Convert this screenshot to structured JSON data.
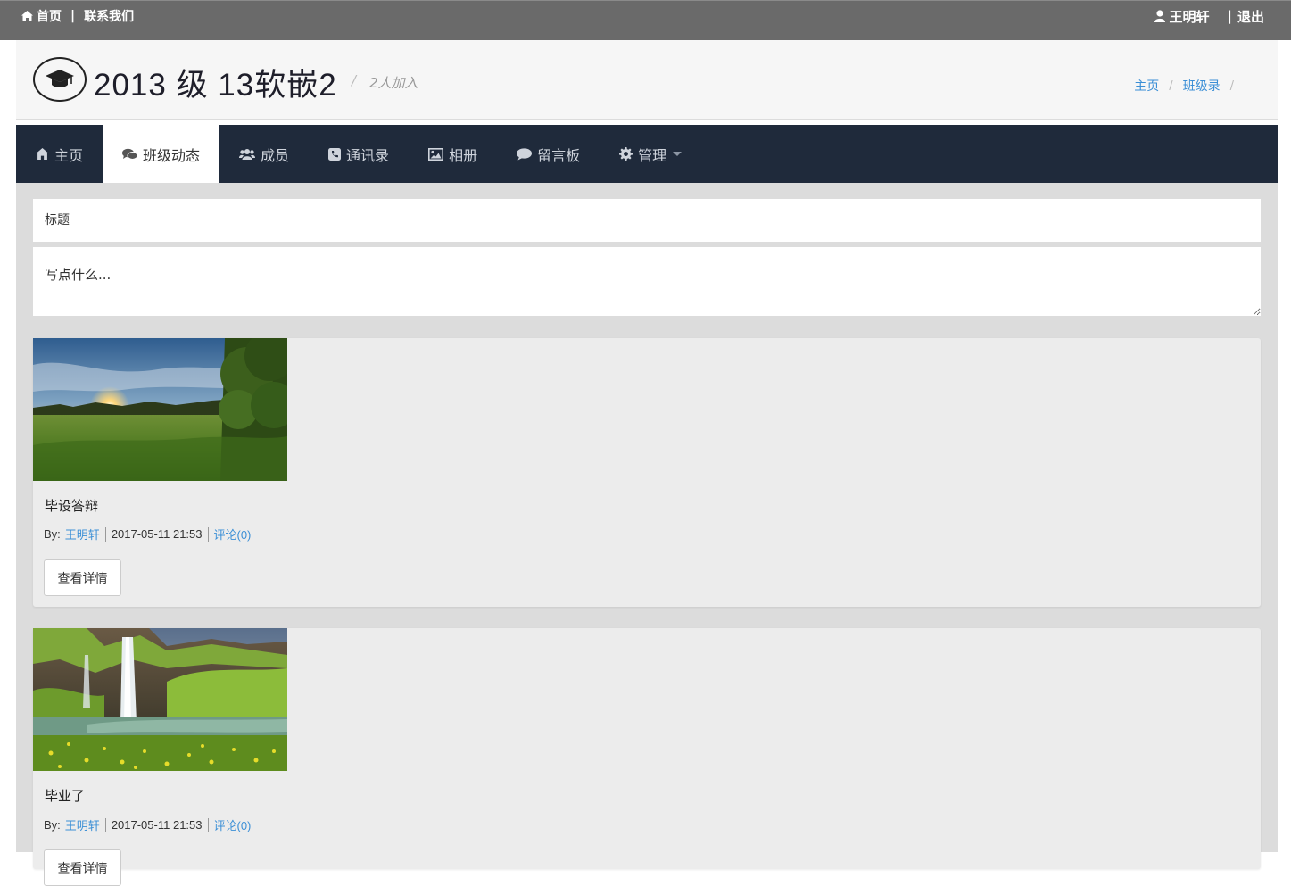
{
  "topbar": {
    "home_label": "首页",
    "contact_label": "联系我们",
    "user_name": "王明轩",
    "logout_label": "退出",
    "separator": "|"
  },
  "header": {
    "title": "2013 级 13软嵌2",
    "separator": "/",
    "join_count": "2人加入",
    "breadcrumb": [
      "主页",
      "班级录"
    ],
    "breadcrumb_sep": "/"
  },
  "nav": {
    "items": [
      {
        "label": "主页",
        "icon": "home-icon"
      },
      {
        "label": "班级动态",
        "icon": "comments-icon",
        "active": true
      },
      {
        "label": "成员",
        "icon": "users-icon"
      },
      {
        "label": "通讯录",
        "icon": "phone-icon"
      },
      {
        "label": "相册",
        "icon": "picture-icon"
      },
      {
        "label": "留言板",
        "icon": "comment-icon"
      },
      {
        "label": "管理",
        "icon": "gear-icon",
        "dropdown": true
      }
    ]
  },
  "composer": {
    "title_placeholder": "标题",
    "content_placeholder": "写点什么..."
  },
  "posts": [
    {
      "title": "毕设答辩",
      "by_label": "By:",
      "author": "王明轩",
      "datetime": "2017-05-11 21:53",
      "comments": "评论(0)",
      "button": "查看详情",
      "image": "sunset-meadow-photo"
    },
    {
      "title": "毕业了",
      "by_label": "By:",
      "author": "王明轩",
      "datetime": "2017-05-11 21:53",
      "comments": "评论(0)",
      "button": "查看详情",
      "image": "waterfall-photo"
    }
  ],
  "colors": {
    "topbar": "#6a6a6a",
    "nav": "#1f2a3b",
    "link": "#3b8fd6",
    "main_bg": "#dcdcdc",
    "card_bg": "#ececec"
  }
}
